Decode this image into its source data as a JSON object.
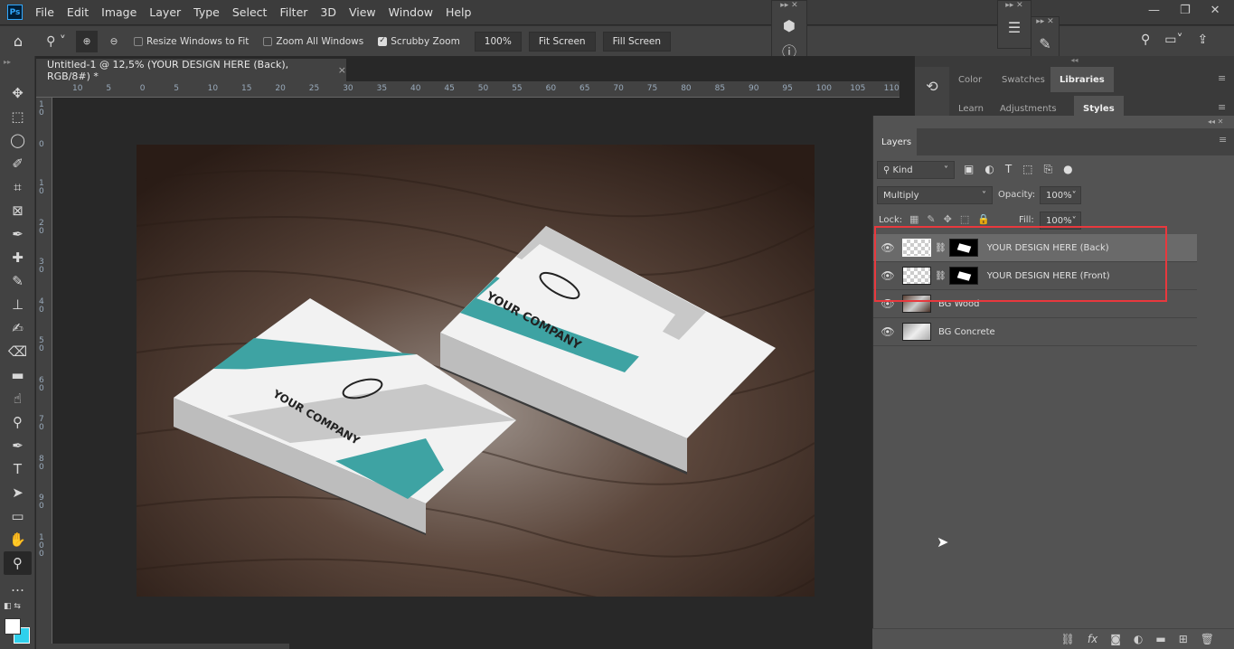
{
  "app": {
    "logo": "Ps"
  },
  "menu": [
    "File",
    "Edit",
    "Image",
    "Layer",
    "Type",
    "Select",
    "Filter",
    "3D",
    "View",
    "Window",
    "Help"
  ],
  "options": {
    "resize_windows": {
      "label": "Resize Windows to Fit",
      "checked": false
    },
    "zoom_all": {
      "label": "Zoom All Windows",
      "checked": false
    },
    "scrubby": {
      "label": "Scrubby Zoom",
      "checked": true
    },
    "zoom_value": "100%",
    "fit_screen": "Fit Screen",
    "fill_screen": "Fill Screen"
  },
  "document": {
    "tab_title": "Untitled-1 @ 12,5% (YOUR DESIGN HERE (Back), RGB/8#) *",
    "close": "×"
  },
  "rulers": {
    "horizontal": [
      "10",
      "5",
      "0",
      "5",
      "10",
      "15",
      "20",
      "25",
      "30",
      "35",
      "40",
      "45",
      "50",
      "55",
      "60",
      "65",
      "70",
      "75",
      "80",
      "85",
      "90",
      "95",
      "100",
      "105",
      "110"
    ],
    "vertical": [
      "10",
      "0",
      "10",
      "20",
      "30",
      "40",
      "50",
      "60",
      "70",
      "80",
      "90",
      "100"
    ]
  },
  "tools": [
    "move-icon",
    "marquee-icon",
    "lasso-icon",
    "quick-select-icon",
    "crop-icon",
    "frame-icon",
    "eyedropper-icon",
    "healing-icon",
    "brush-icon",
    "stamp-icon",
    "history-brush-icon",
    "eraser-icon",
    "gradient-icon",
    "smudge-icon",
    "dodge-icon",
    "pen-icon",
    "type-icon",
    "path-select-icon",
    "rectangle-icon",
    "hand-icon",
    "zoom-icon",
    "more-icon"
  ],
  "colors": {
    "foreground": "#ffffff",
    "background": "#2fd0ec",
    "accent": "#31a8ff",
    "highlight_box": "#e8383d",
    "teal": "#3ea3a3"
  },
  "canvas": {
    "card_text": "YOUR COMPANY"
  },
  "panels": {
    "row1": [
      "Color",
      "Swatches",
      "Libraries"
    ],
    "row1_active": "Libraries",
    "row2": [
      "Learn",
      "Adjustments",
      "Styles"
    ],
    "row2_active": "Styles"
  },
  "layers": {
    "tab": "Layers",
    "filter": "Kind",
    "blend_mode": "Multiply",
    "opacity_label": "Opacity:",
    "opacity": "100%",
    "lock_label": "Lock:",
    "fill_label": "Fill:",
    "fill": "100%",
    "items": [
      {
        "name": "YOUR DESIGN HERE (Back)",
        "visible": true,
        "selected": true
      },
      {
        "name": "YOUR DESIGN HERE (Front)",
        "visible": true,
        "selected": false
      },
      {
        "name": "BG Wood",
        "visible": true,
        "selected": false
      },
      {
        "name": "BG Concrete",
        "visible": true,
        "selected": false
      }
    ],
    "footer_icons": [
      "link-icon",
      "fx-icon",
      "mask-icon",
      "adjustment-icon",
      "folder-icon",
      "new-layer-icon",
      "trash-icon"
    ],
    "fx_label": "fx"
  }
}
